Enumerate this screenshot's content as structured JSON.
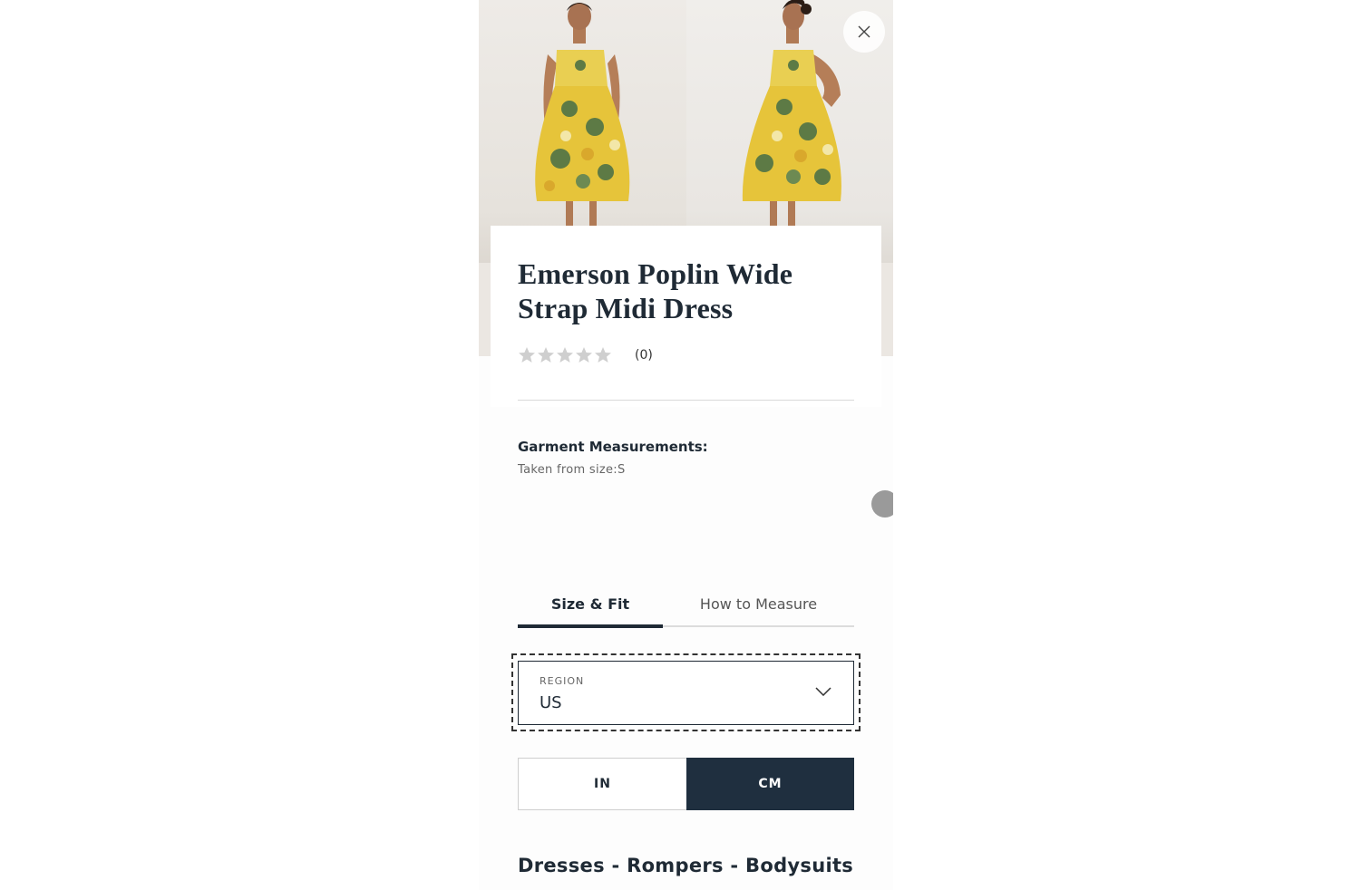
{
  "product": {
    "title": "Emerson Poplin Wide Strap Midi Dress",
    "rating_value": 0,
    "rating_max": 5,
    "review_count": "(0)"
  },
  "close": {
    "icon": "close-icon"
  },
  "garment": {
    "heading": "Garment Measurements:",
    "subheading": "Taken from size:S"
  },
  "tabs": [
    {
      "label": "Size & Fit",
      "active": true
    },
    {
      "label": "How to Measure",
      "active": false
    }
  ],
  "region": {
    "label": "REGION",
    "value": "US"
  },
  "units": [
    {
      "label": "IN",
      "selected": false
    },
    {
      "label": "CM",
      "selected": true
    }
  ],
  "category": "Dresses - Rompers - Bodysuits",
  "colors": {
    "primary": "#1f2f3f",
    "star_empty": "#cfcfcf",
    "dress_yellow": "#e6c43a",
    "dress_green": "#5d7a45"
  }
}
